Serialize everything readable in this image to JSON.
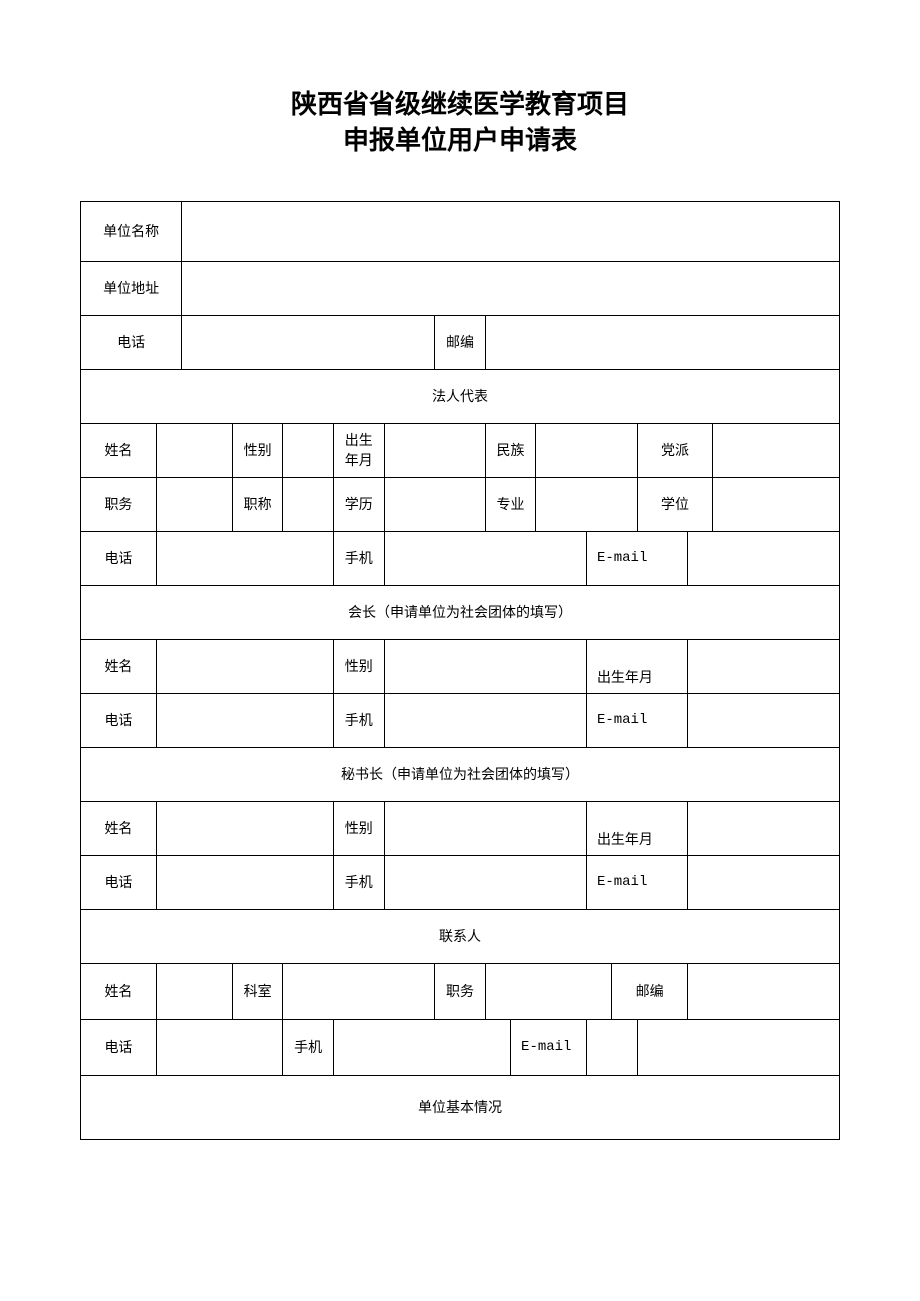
{
  "title_line1": "陕西省省级继续医学教育项目",
  "title_line2": "申报单位用户申请表",
  "labels": {
    "unit_name": "单位名称",
    "unit_addr": "单位地址",
    "phone": "电话",
    "postcode": "邮编",
    "legal_rep": "法人代表",
    "name": "姓名",
    "gender": "性别",
    "birth": "出生\n年月",
    "birth_single": "出生年月",
    "ethnicity": "民族",
    "party": "党派",
    "position": "职务",
    "title_rank": "职称",
    "education": "学历",
    "major": "专业",
    "degree": "学位",
    "mobile": "手机",
    "email": "E-mail",
    "president": "会长（申请单位为社会团体的填写）",
    "secretary": "秘书长（申请单位为社会团体的填写）",
    "contact": "联系人",
    "dept": "科室",
    "basic_info": "单位基本情况"
  },
  "values": {
    "unit_name": "",
    "unit_addr": "",
    "phone": "",
    "postcode": "",
    "legal": {
      "name": "",
      "gender": "",
      "birth": "",
      "ethnicity": "",
      "party": "",
      "position": "",
      "title_rank": "",
      "education": "",
      "major": "",
      "degree": "",
      "phone": "",
      "mobile": "",
      "email": ""
    },
    "president": {
      "name": "",
      "gender": "",
      "birth": "",
      "phone": "",
      "mobile": "",
      "email": ""
    },
    "secretary": {
      "name": "",
      "gender": "",
      "birth": "",
      "phone": "",
      "mobile": "",
      "email": ""
    },
    "contact": {
      "name": "",
      "dept": "",
      "position": "",
      "postcode": "",
      "phone": "",
      "mobile": "",
      "email": ""
    }
  }
}
